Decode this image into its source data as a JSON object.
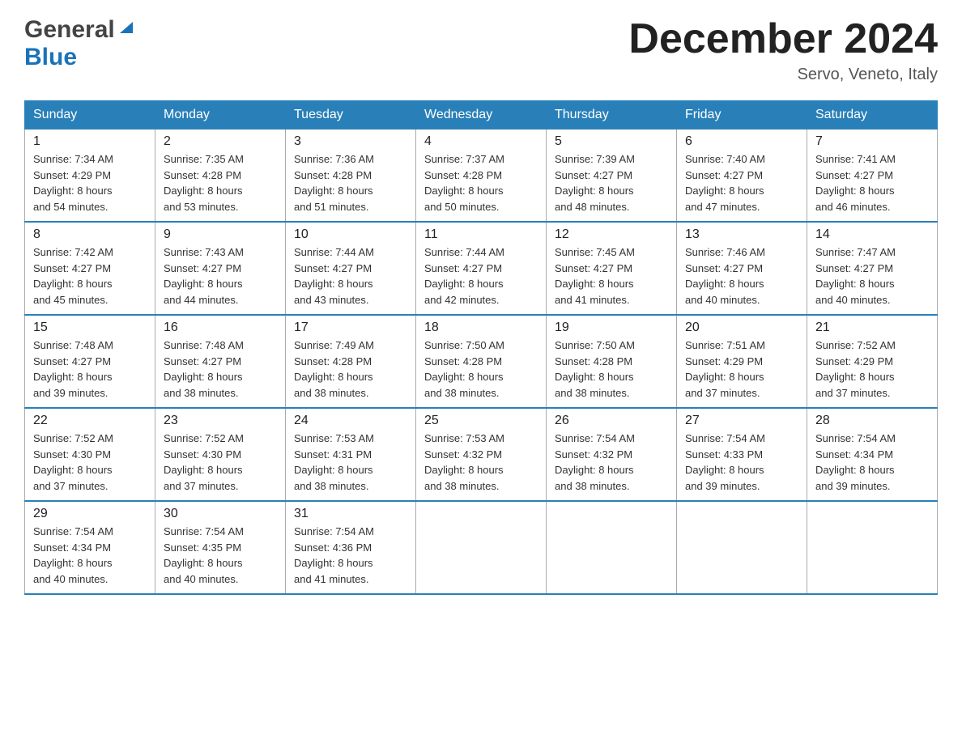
{
  "header": {
    "logo": {
      "general": "General",
      "blue": "Blue"
    },
    "title": "December 2024",
    "location": "Servo, Veneto, Italy"
  },
  "days_of_week": [
    "Sunday",
    "Monday",
    "Tuesday",
    "Wednesday",
    "Thursday",
    "Friday",
    "Saturday"
  ],
  "weeks": [
    [
      {
        "day": "1",
        "sunrise": "7:34 AM",
        "sunset": "4:29 PM",
        "daylight": "8 hours and 54 minutes."
      },
      {
        "day": "2",
        "sunrise": "7:35 AM",
        "sunset": "4:28 PM",
        "daylight": "8 hours and 53 minutes."
      },
      {
        "day": "3",
        "sunrise": "7:36 AM",
        "sunset": "4:28 PM",
        "daylight": "8 hours and 51 minutes."
      },
      {
        "day": "4",
        "sunrise": "7:37 AM",
        "sunset": "4:28 PM",
        "daylight": "8 hours and 50 minutes."
      },
      {
        "day": "5",
        "sunrise": "7:39 AM",
        "sunset": "4:27 PM",
        "daylight": "8 hours and 48 minutes."
      },
      {
        "day": "6",
        "sunrise": "7:40 AM",
        "sunset": "4:27 PM",
        "daylight": "8 hours and 47 minutes."
      },
      {
        "day": "7",
        "sunrise": "7:41 AM",
        "sunset": "4:27 PM",
        "daylight": "8 hours and 46 minutes."
      }
    ],
    [
      {
        "day": "8",
        "sunrise": "7:42 AM",
        "sunset": "4:27 PM",
        "daylight": "8 hours and 45 minutes."
      },
      {
        "day": "9",
        "sunrise": "7:43 AM",
        "sunset": "4:27 PM",
        "daylight": "8 hours and 44 minutes."
      },
      {
        "day": "10",
        "sunrise": "7:44 AM",
        "sunset": "4:27 PM",
        "daylight": "8 hours and 43 minutes."
      },
      {
        "day": "11",
        "sunrise": "7:44 AM",
        "sunset": "4:27 PM",
        "daylight": "8 hours and 42 minutes."
      },
      {
        "day": "12",
        "sunrise": "7:45 AM",
        "sunset": "4:27 PM",
        "daylight": "8 hours and 41 minutes."
      },
      {
        "day": "13",
        "sunrise": "7:46 AM",
        "sunset": "4:27 PM",
        "daylight": "8 hours and 40 minutes."
      },
      {
        "day": "14",
        "sunrise": "7:47 AM",
        "sunset": "4:27 PM",
        "daylight": "8 hours and 40 minutes."
      }
    ],
    [
      {
        "day": "15",
        "sunrise": "7:48 AM",
        "sunset": "4:27 PM",
        "daylight": "8 hours and 39 minutes."
      },
      {
        "day": "16",
        "sunrise": "7:48 AM",
        "sunset": "4:27 PM",
        "daylight": "8 hours and 38 minutes."
      },
      {
        "day": "17",
        "sunrise": "7:49 AM",
        "sunset": "4:28 PM",
        "daylight": "8 hours and 38 minutes."
      },
      {
        "day": "18",
        "sunrise": "7:50 AM",
        "sunset": "4:28 PM",
        "daylight": "8 hours and 38 minutes."
      },
      {
        "day": "19",
        "sunrise": "7:50 AM",
        "sunset": "4:28 PM",
        "daylight": "8 hours and 38 minutes."
      },
      {
        "day": "20",
        "sunrise": "7:51 AM",
        "sunset": "4:29 PM",
        "daylight": "8 hours and 37 minutes."
      },
      {
        "day": "21",
        "sunrise": "7:52 AM",
        "sunset": "4:29 PM",
        "daylight": "8 hours and 37 minutes."
      }
    ],
    [
      {
        "day": "22",
        "sunrise": "7:52 AM",
        "sunset": "4:30 PM",
        "daylight": "8 hours and 37 minutes."
      },
      {
        "day": "23",
        "sunrise": "7:52 AM",
        "sunset": "4:30 PM",
        "daylight": "8 hours and 37 minutes."
      },
      {
        "day": "24",
        "sunrise": "7:53 AM",
        "sunset": "4:31 PM",
        "daylight": "8 hours and 38 minutes."
      },
      {
        "day": "25",
        "sunrise": "7:53 AM",
        "sunset": "4:32 PM",
        "daylight": "8 hours and 38 minutes."
      },
      {
        "day": "26",
        "sunrise": "7:54 AM",
        "sunset": "4:32 PM",
        "daylight": "8 hours and 38 minutes."
      },
      {
        "day": "27",
        "sunrise": "7:54 AM",
        "sunset": "4:33 PM",
        "daylight": "8 hours and 39 minutes."
      },
      {
        "day": "28",
        "sunrise": "7:54 AM",
        "sunset": "4:34 PM",
        "daylight": "8 hours and 39 minutes."
      }
    ],
    [
      {
        "day": "29",
        "sunrise": "7:54 AM",
        "sunset": "4:34 PM",
        "daylight": "8 hours and 40 minutes."
      },
      {
        "day": "30",
        "sunrise": "7:54 AM",
        "sunset": "4:35 PM",
        "daylight": "8 hours and 40 minutes."
      },
      {
        "day": "31",
        "sunrise": "7:54 AM",
        "sunset": "4:36 PM",
        "daylight": "8 hours and 41 minutes."
      },
      null,
      null,
      null,
      null
    ]
  ],
  "labels": {
    "sunrise": "Sunrise:",
    "sunset": "Sunset:",
    "daylight": "Daylight:"
  }
}
